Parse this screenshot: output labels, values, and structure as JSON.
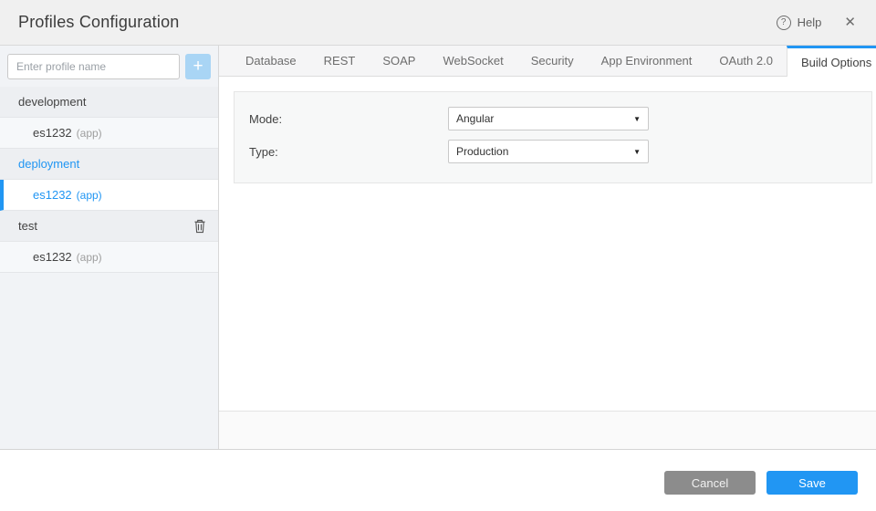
{
  "header": {
    "title": "Profiles Configuration",
    "help_label": "Help"
  },
  "icons": {
    "help": "?",
    "close": "✕",
    "add": "+",
    "dropdown_caret": "▼"
  },
  "sidebar": {
    "profile_input": {
      "placeholder": "Enter profile name",
      "value": ""
    },
    "rows": [
      {
        "type": "group",
        "label": "development",
        "selected": false,
        "deletable": false
      },
      {
        "type": "item",
        "label": "es1232",
        "suffix": "(app)",
        "selected": false
      },
      {
        "type": "group",
        "label": "deployment",
        "selected": true,
        "deletable": false
      },
      {
        "type": "item",
        "label": "es1232",
        "suffix": "(app)",
        "selected": true
      },
      {
        "type": "group",
        "label": "test",
        "selected": false,
        "deletable": true
      },
      {
        "type": "item",
        "label": "es1232",
        "suffix": "(app)",
        "selected": false
      }
    ]
  },
  "tabs": [
    {
      "label": "Database",
      "active": false
    },
    {
      "label": "REST",
      "active": false
    },
    {
      "label": "SOAP",
      "active": false
    },
    {
      "label": "WebSocket",
      "active": false
    },
    {
      "label": "Security",
      "active": false
    },
    {
      "label": "App Environment",
      "active": false
    },
    {
      "label": "OAuth 2.0",
      "active": false
    },
    {
      "label": "Build Options",
      "active": true
    }
  ],
  "form": {
    "fields": [
      {
        "label": "Mode:",
        "value": "Angular"
      },
      {
        "label": "Type:",
        "value": "Production"
      }
    ]
  },
  "footer": {
    "cancel_label": "Cancel",
    "save_label": "Save"
  },
  "colors": {
    "accent": "#2196f3",
    "cancel_button": "#8c8c8c",
    "add_button": "#a9d5f5"
  }
}
